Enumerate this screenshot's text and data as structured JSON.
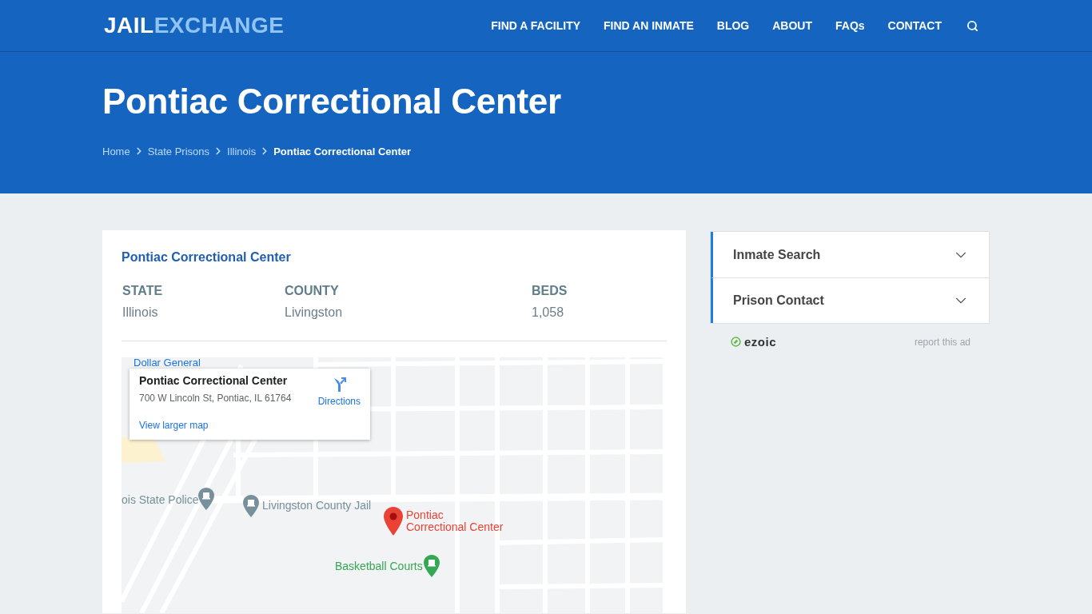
{
  "header": {
    "logo": {
      "first_part": "JAIL",
      "second_part": "EXCHANGE"
    },
    "nav": [
      {
        "label": "FIND A FACILITY"
      },
      {
        "label": "FIND AN INMATE"
      },
      {
        "label": "BLOG"
      },
      {
        "label": "ABOUT"
      },
      {
        "label": "FAQs"
      },
      {
        "label": "CONTACT"
      }
    ]
  },
  "hero": {
    "title": "Pontiac Correctional Center",
    "breadcrumb": [
      {
        "label": "Home",
        "current": false
      },
      {
        "label": "State Prisons",
        "current": false
      },
      {
        "label": "Illinois",
        "current": false
      },
      {
        "label": "Pontiac Correctional Center",
        "current": true
      }
    ]
  },
  "facility_card": {
    "title": "Pontiac Correctional Center",
    "stats": [
      {
        "label": "STATE",
        "value": "Illinois"
      },
      {
        "label": "COUNTY",
        "value": "Livingston"
      },
      {
        "label": "BEDS",
        "value": "1,058"
      }
    ],
    "map": {
      "info_card": {
        "name": "Pontiac Correctional Center",
        "address": "700 W Lincoln St, Pontiac, IL 61764",
        "directions": "Directions",
        "link": "View larger map"
      },
      "pins": [
        {
          "kind": "text",
          "label": "Dollar General",
          "color": "#1a73e8"
        },
        {
          "kind": "poi",
          "label": "ois State Police",
          "color": "#78909c"
        },
        {
          "kind": "poi",
          "label": "Livingston County Jail",
          "color": "#78909c"
        },
        {
          "kind": "marker",
          "label": "Pontiac Correctional Center",
          "color": "#ea4335"
        },
        {
          "kind": "poi",
          "label": "Basketball Courts",
          "color": "#34a853"
        }
      ]
    }
  },
  "sidebar": {
    "accordions": [
      {
        "label": "Inmate Search",
        "expanded": false
      },
      {
        "label": "Prison Contact",
        "expanded": false
      }
    ],
    "ad": {
      "brand": "ezoic",
      "report": "report this ad"
    }
  }
}
